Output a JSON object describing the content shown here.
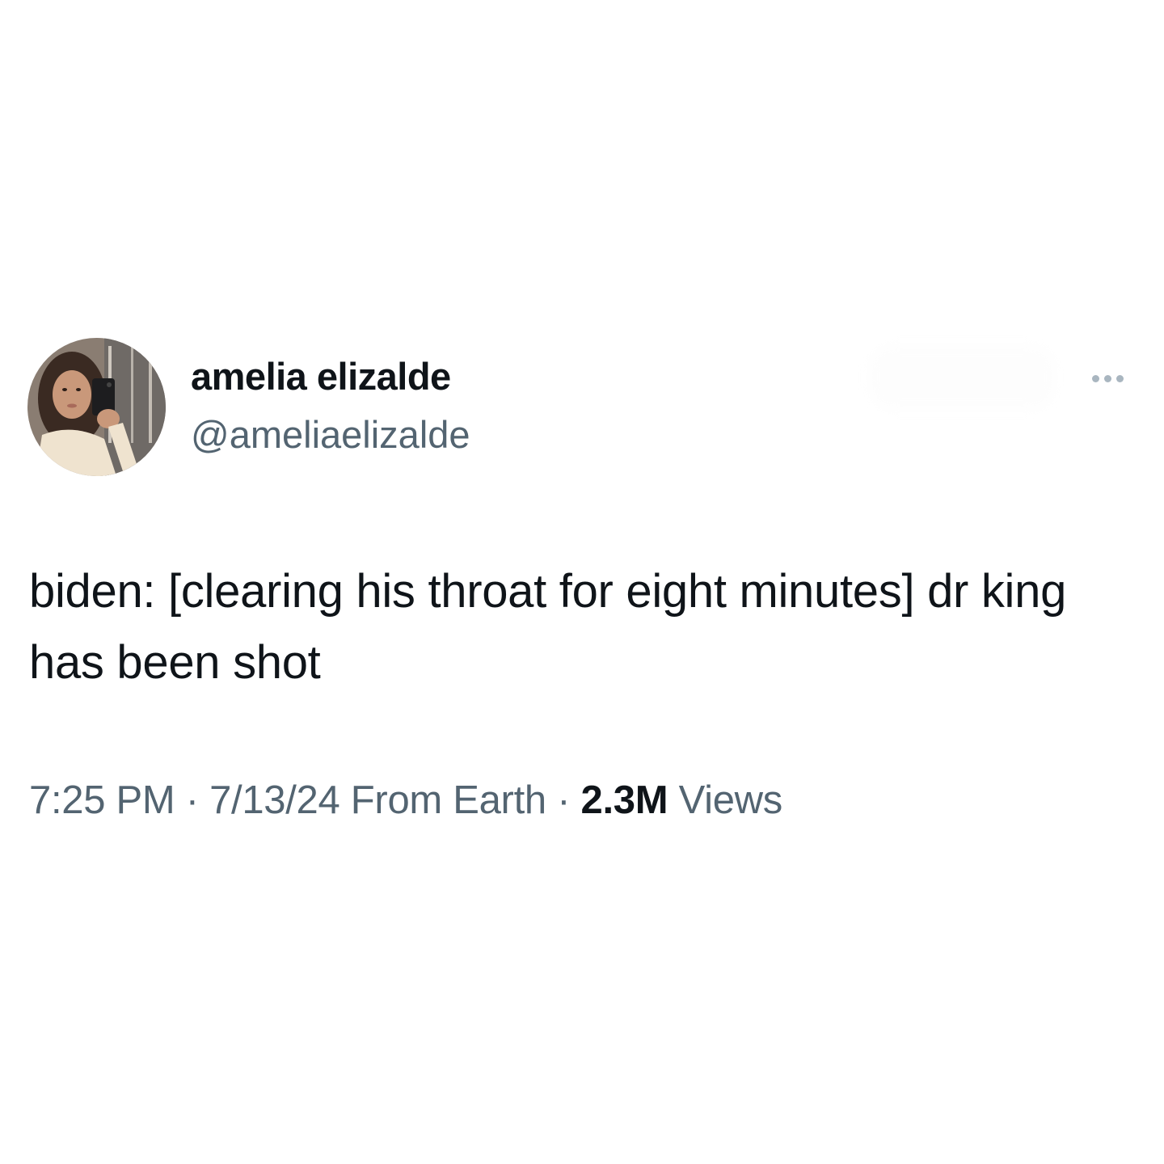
{
  "author": {
    "display_name": "amelia elizalde",
    "handle": "@ameliaelizalde",
    "avatar_icon": "profile-photo-avatar"
  },
  "actions": {
    "more_icon": "more-horizontal-icon"
  },
  "tweet": {
    "text": "biden: [clearing his throat for eight minutes] dr king has been shot"
  },
  "meta": {
    "time": "7:25 PM",
    "separator": "·",
    "date": "7/13/24",
    "source": "From Earth",
    "views_count": "2.3M",
    "views_label": "Views"
  },
  "colors": {
    "primary_text": "#0f1419",
    "secondary_text": "#536471",
    "more_dots": "#a9b6c0",
    "background": "#ffffff"
  }
}
